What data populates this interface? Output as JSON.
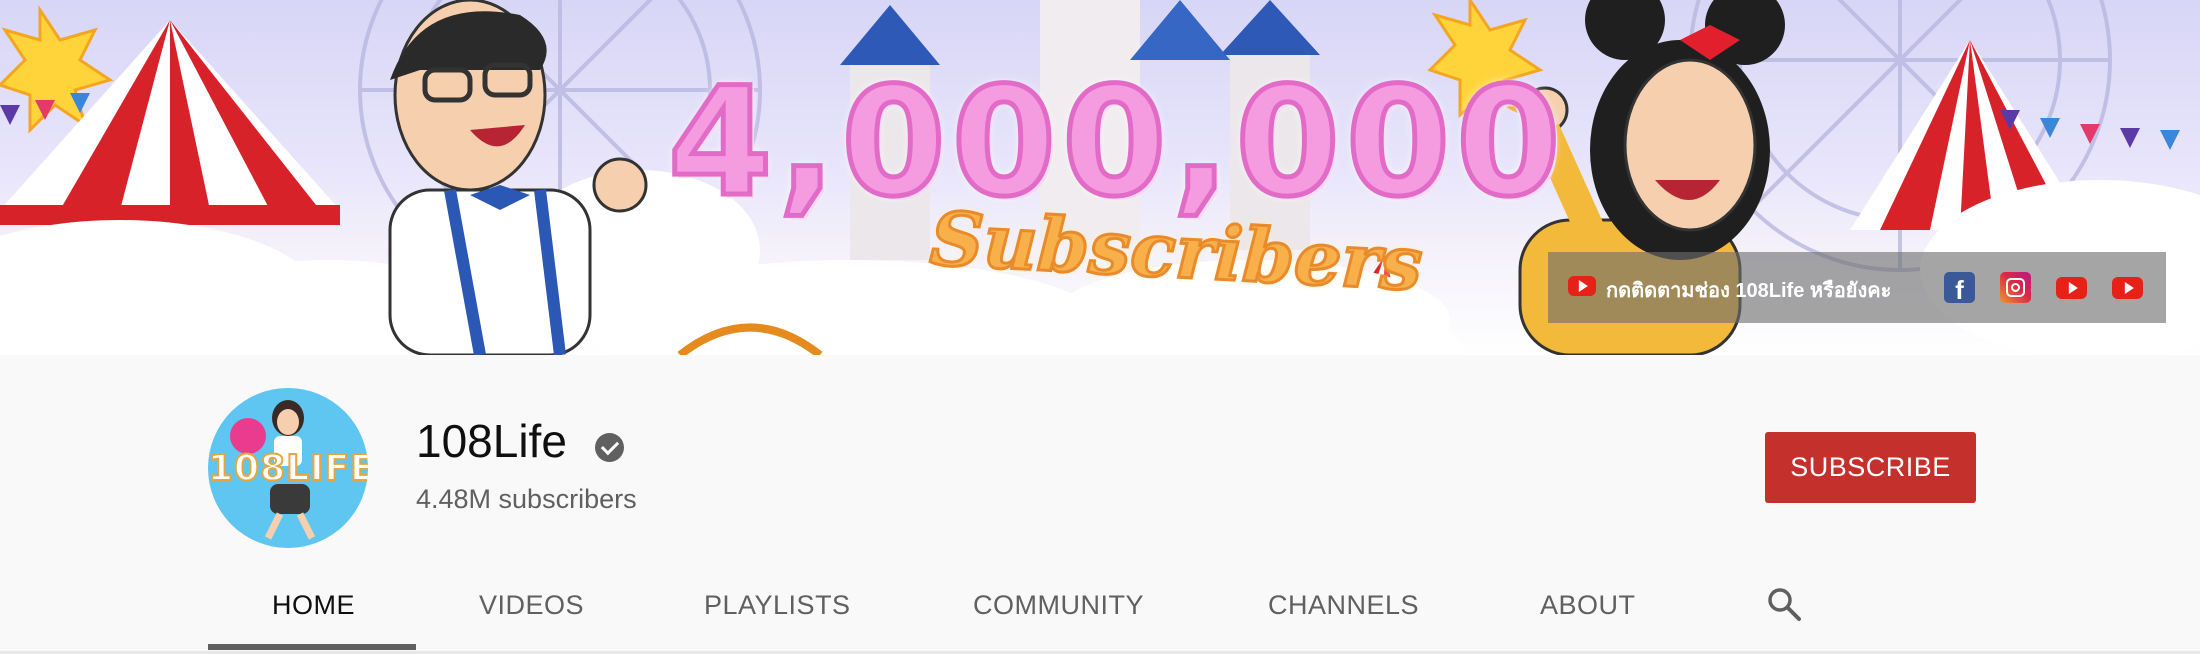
{
  "banner": {
    "milestone_number": "4,000,000",
    "milestone_label": "Subscribers",
    "follow_text": "กดติดตามช่อง 108Life หรือยังคะ",
    "social_icons": [
      "youtube-icon",
      "facebook-icon",
      "instagram-icon",
      "youtube-icon",
      "youtube-icon"
    ],
    "facebook_glyph": "f"
  },
  "channel": {
    "name": "108Life",
    "subscribers": "4.48M subscribers",
    "avatar_text": "108LIFE",
    "verified": true
  },
  "actions": {
    "subscribe_label": "SUBSCRIBE"
  },
  "tabs": [
    {
      "label": "HOME",
      "active": true
    },
    {
      "label": "VIDEOS",
      "active": false
    },
    {
      "label": "PLAYLISTS",
      "active": false
    },
    {
      "label": "COMMUNITY",
      "active": false
    },
    {
      "label": "CHANNELS",
      "active": false
    },
    {
      "label": "ABOUT",
      "active": false
    }
  ],
  "colors": {
    "subscribe_bg": "#c4302b",
    "page_bg": "#f9f9f9",
    "milestone_pink": "#f59be0",
    "milestone_orange": "#f7b04a"
  }
}
